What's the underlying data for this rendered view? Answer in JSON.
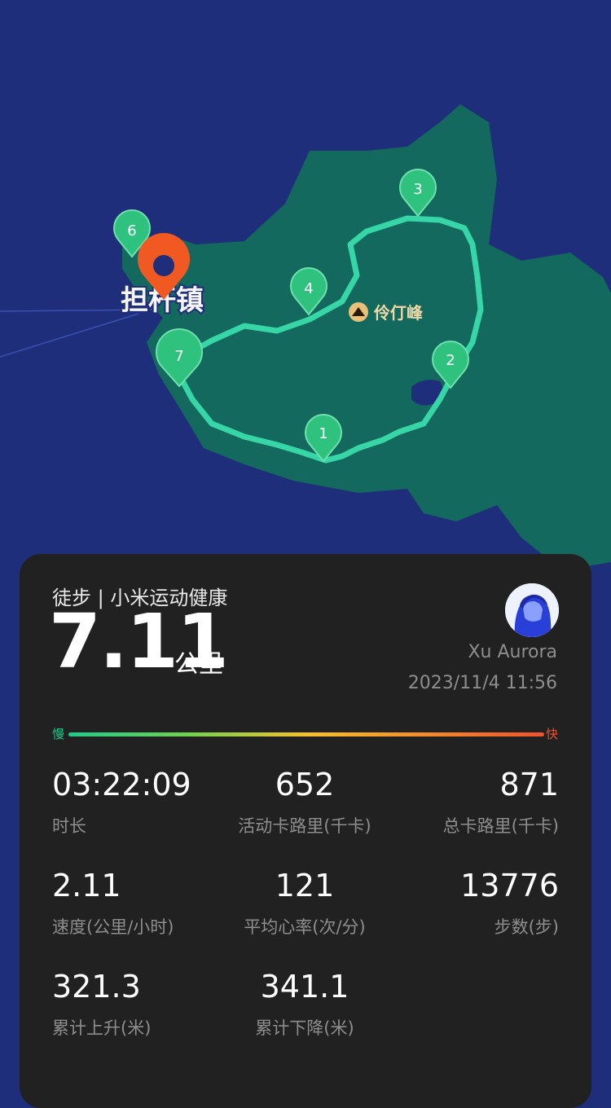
{
  "map": {
    "town_label": "担杆镇",
    "peak_label": "伶仃峰",
    "markers": [
      "1",
      "2",
      "3",
      "4",
      "6",
      "7"
    ]
  },
  "summary": {
    "sport": "徒步 | 小米运动健康",
    "distance": "7.11",
    "unit": "公里",
    "username": "Xu Aurora",
    "datetime": "2023/11/4 11:56"
  },
  "speed_legend": {
    "slow": "慢",
    "fast": "快"
  },
  "stats": [
    {
      "value": "03:22:09",
      "label": "时长"
    },
    {
      "value": "652",
      "label": "活动卡路里(千卡)"
    },
    {
      "value": "871",
      "label": "总卡路里(千卡)"
    },
    {
      "value": "2.11",
      "label": "速度(公里/小时)"
    },
    {
      "value": "121",
      "label": "平均心率(次/分)"
    },
    {
      "value": "13776",
      "label": "步数(步)"
    },
    {
      "value": "321.3",
      "label": "累计上升(米)"
    },
    {
      "value": "341.1",
      "label": "累计下降(米)"
    }
  ],
  "colors": {
    "sea": "#1f2e7a",
    "land": "#13695e",
    "route": "#36d6a6",
    "marker": "#2ec27e",
    "pin": "#f05a22",
    "card": "#212121"
  }
}
